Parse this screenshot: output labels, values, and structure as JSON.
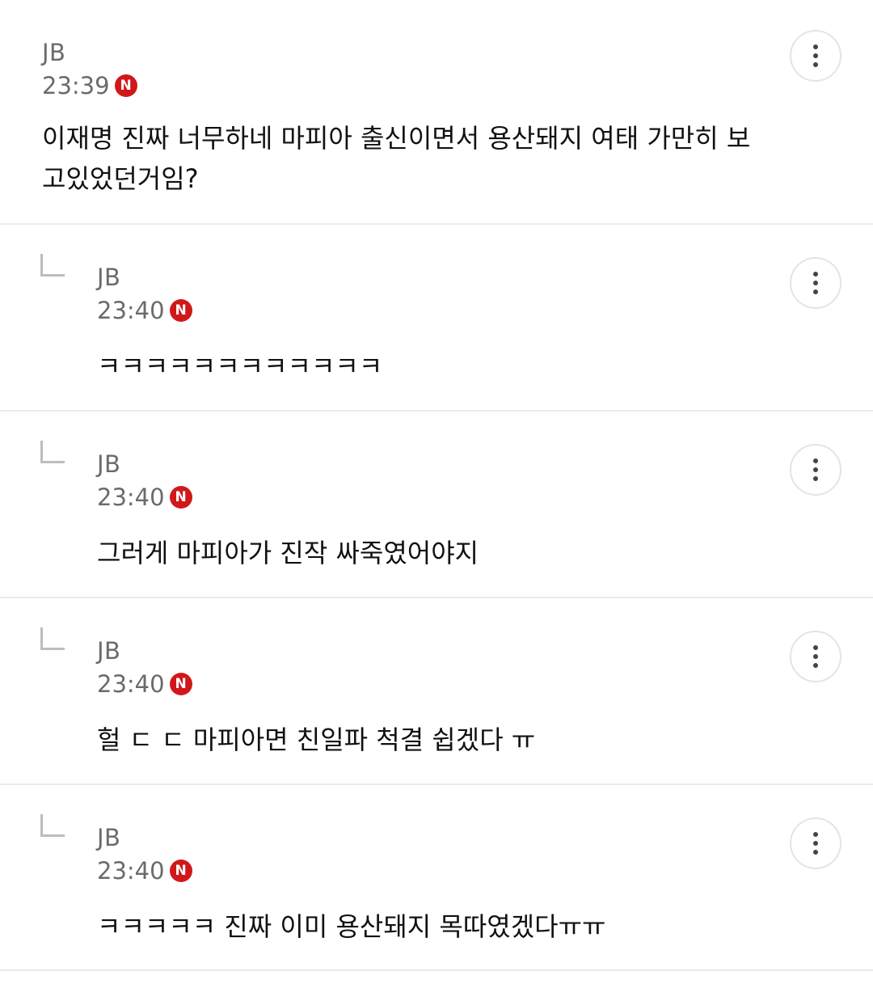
{
  "comments": [
    {
      "author": "JB",
      "time": "23:39",
      "badge": "N",
      "text": "이재명 진짜 너무하네 마피아 출신이면서 용산돼지 여태 가만히 보고있었던거임?"
    },
    {
      "author": "JB",
      "time": "23:40",
      "badge": "N",
      "text": "ㅋㅋㅋㅋㅋㅋㅋㅋㅋㅋㅋㅋ"
    },
    {
      "author": "JB",
      "time": "23:40",
      "badge": "N",
      "text": "그러게 마피아가 진작 싸죽였어야지"
    },
    {
      "author": "JB",
      "time": "23:40",
      "badge": "N",
      "text": "헐 ㄷ ㄷ 마피아면 친일파 척결 쉽겠다 ㅠ"
    },
    {
      "author": "JB",
      "time": "23:40",
      "badge": "N",
      "text": "ㅋㅋㅋㅋㅋ 진짜 이미 용산돼지 목따였겠다ㅠㅠ"
    }
  ],
  "icons": {
    "more": "more-vertical-icon",
    "reply": "reply-arrow-icon",
    "new": "new-badge-icon"
  },
  "colors": {
    "badge": "#d0181b",
    "meta_text": "#6b6b6b",
    "divider": "#ececec"
  }
}
